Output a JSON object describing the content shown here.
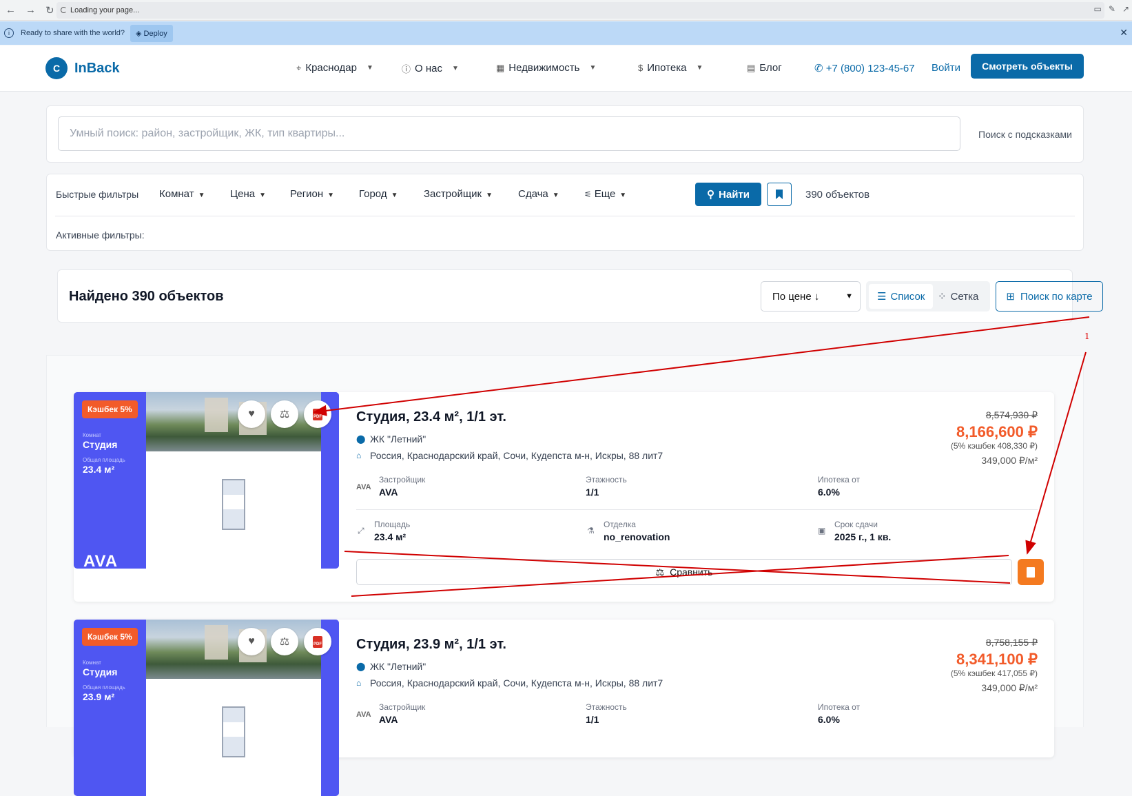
{
  "browser": {
    "url_status": "Loading your page..."
  },
  "deploy_bar": {
    "message": "Ready to share with the world?",
    "button": "Deploy"
  },
  "header": {
    "logo_letter": "C",
    "logo_text": "InBack",
    "nav": [
      {
        "label": "Краснодар",
        "icon": "location-pin-icon"
      },
      {
        "label": "О нас",
        "icon": "info-icon"
      },
      {
        "label": "Недвижимость",
        "icon": "building-icon"
      },
      {
        "label": "Ипотека",
        "icon": "currency-icon"
      },
      {
        "label": "Блог",
        "icon": "newspaper-icon"
      }
    ],
    "phone": "+7 (800) 123-45-67",
    "login": "Войти",
    "cta": "Смотреть объекты"
  },
  "search": {
    "placeholder": "Умный поиск: район, застройщик, ЖК, тип квартиры...",
    "hint": "Поиск с подсказками"
  },
  "filters": {
    "label": "Быстрые фильтры",
    "items": [
      "Комнат",
      "Цена",
      "Регион",
      "Город",
      "Застройщик",
      "Сдача",
      "Еще"
    ],
    "find": "Найти",
    "count": "390 объектов",
    "active_label": "Активные фильтры:"
  },
  "results": {
    "title": "Найдено 390 объектов",
    "sort": "По цене ↓",
    "view_list": "Список",
    "view_grid": "Сетка",
    "map": "Поиск по карте"
  },
  "listings": [
    {
      "cashback": "Кэшбек 5%",
      "thumb_rooms_label": "Комнат",
      "thumb_rooms": "Студия",
      "thumb_area_label": "Общая площадь",
      "thumb_area": "23.4 м²",
      "brand": "AVA",
      "title": "Студия, 23.4 м², 1/1 эт.",
      "complex": "ЖК \"Летний\"",
      "address": "Россия, Краснодарский край, Сочи, Кудепста м-н, Искры, 88 лит7",
      "old_price": "8,574,930 ₽",
      "price": "8,166,600 ₽",
      "cashback_note": "(5% кэшбек 408,330 ₽)",
      "price_per_m": "349,000 ₽/м²",
      "developer_label": "Застройщик",
      "developer": "AVA",
      "floors_label": "Этажность",
      "floors": "1/1",
      "mortgage_label": "Ипотека от",
      "mortgage": "6.0%",
      "area_label": "Площадь",
      "area": "23.4 м²",
      "finish_label": "Отделка",
      "finish": "no_renovation",
      "deadline_label": "Срок сдачи",
      "deadline": "2025 г., 1 кв.",
      "compare": "Сравнить"
    },
    {
      "cashback": "Кэшбек 5%",
      "thumb_rooms_label": "Комнат",
      "thumb_rooms": "Студия",
      "thumb_area_label": "Общая площадь",
      "thumb_area": "23.9 м²",
      "title": "Студия, 23.9 м², 1/1 эт.",
      "complex": "ЖК \"Летний\"",
      "address": "Россия, Краснодарский край, Сочи, Кудепста м-н, Искры, 88 лит7",
      "old_price": "8,758,155 ₽",
      "price": "8,341,100 ₽",
      "cashback_note": "(5% кэшбек 417,055 ₽)",
      "price_per_m": "349,000 ₽/м²",
      "developer_label": "Застройщик",
      "developer": "AVA",
      "floors_label": "Этажность",
      "floors": "1/1",
      "mortgage_label": "Ипотека от",
      "mortgage": "6.0%"
    }
  ],
  "annotation": {
    "number": "1",
    "color": "#d00000"
  }
}
